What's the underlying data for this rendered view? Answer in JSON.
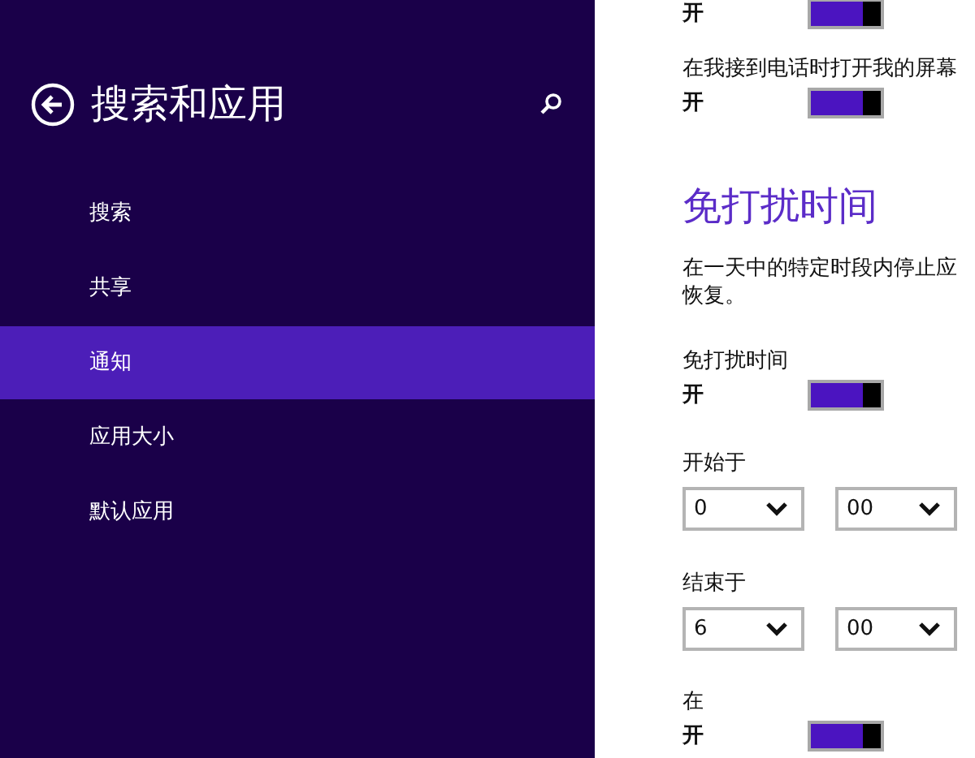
{
  "sidebar": {
    "title": "搜索和应用",
    "items": [
      {
        "label": "搜索",
        "selected": false
      },
      {
        "label": "共享",
        "selected": false
      },
      {
        "label": "通知",
        "selected": true
      },
      {
        "label": "应用大小",
        "selected": false
      },
      {
        "label": "默认应用",
        "selected": false
      }
    ]
  },
  "content": {
    "items": [
      {
        "kind": "toggle",
        "state": "开",
        "on": true
      },
      {
        "kind": "toggle",
        "label": "在我接到电话时打开我的屏幕",
        "state": "开",
        "on": true
      },
      {
        "kind": "heading",
        "text": "免打扰时间"
      },
      {
        "kind": "paragraph",
        "lines": [
          "在一天中的特定时段内停止应",
          "恢复。"
        ]
      },
      {
        "kind": "toggle",
        "label": "免打扰时间",
        "state": "开",
        "on": true
      },
      {
        "kind": "time",
        "label": "开始于",
        "hour": "0",
        "minute": "00"
      },
      {
        "kind": "time",
        "label": "结束于",
        "hour": "6",
        "minute": "00"
      },
      {
        "kind": "toggle",
        "label": "在",
        "state": "开",
        "on": true
      }
    ]
  }
}
